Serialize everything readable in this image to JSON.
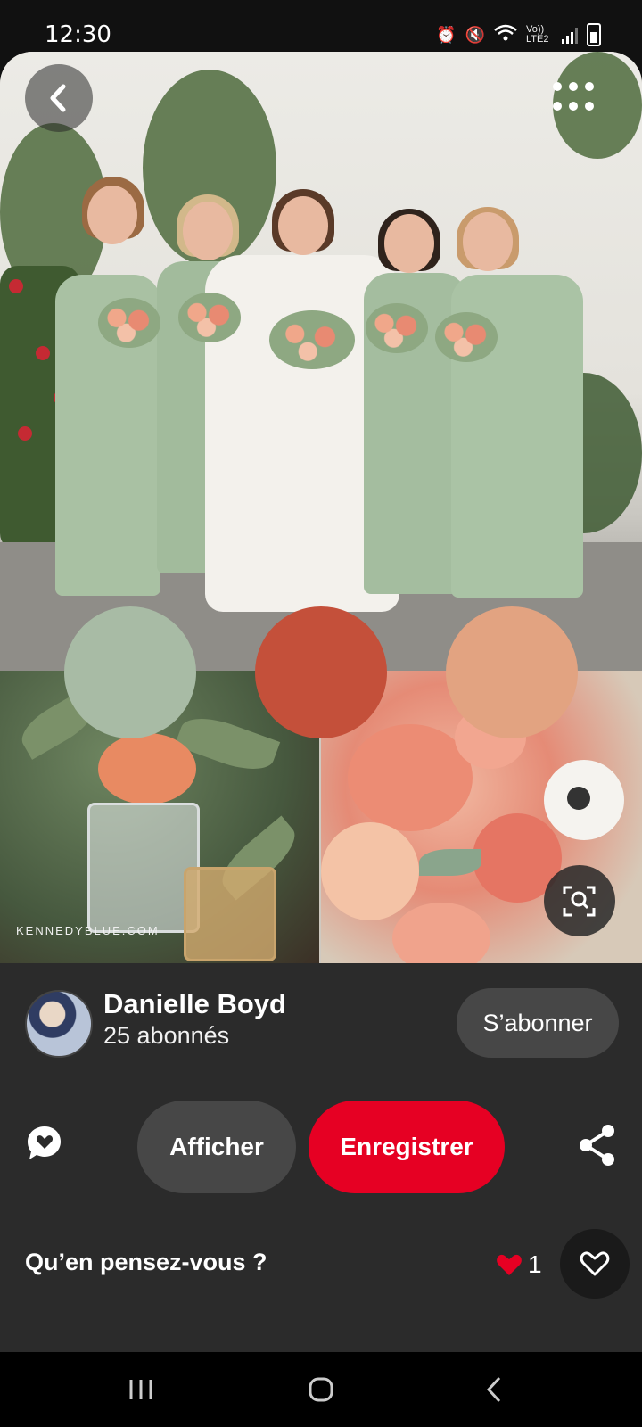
{
  "status_bar": {
    "time": "12:30",
    "network": "Vo)) LTE2"
  },
  "image": {
    "watermark": "KENNEDYBLUE.COM",
    "palette": [
      "#a8bba5",
      "#c4503a",
      "#e2a381"
    ]
  },
  "pin": {
    "author_name": "Danielle Boyd",
    "author_followers": "25 abonnés",
    "follow_label": "S’abonner"
  },
  "actions": {
    "view_label": "Afficher",
    "save_label": "Enregistrer"
  },
  "comments": {
    "prompt": "Qu’en pensez-vous ?",
    "like_count": "1"
  },
  "icons": {
    "back": "chevron-left-icon",
    "more": "more-dots-icon",
    "lens": "visual-search-icon",
    "comment": "comment-heart-icon",
    "share": "share-icon",
    "like": "heart-outline-icon"
  },
  "colors": {
    "save_red": "#e60023",
    "background": "#2b2b2b"
  }
}
